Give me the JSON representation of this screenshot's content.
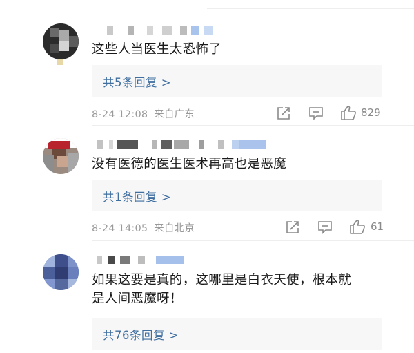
{
  "comments": [
    {
      "text_lines": [
        "这些人当医生太恐怖了"
      ],
      "replies": "共5条回复 >",
      "time": "8-24 12:08",
      "location": "来自广东",
      "likes": "829"
    },
    {
      "text_lines": [
        "没有医德的医生医术再高也是恶魔"
      ],
      "replies": "共1条回复 >",
      "time": "8-24 14:05",
      "location": "来自北京",
      "likes": "61"
    },
    {
      "text_lines": [
        "如果这要是真的，这哪里是白衣天使，根本就",
        "是人间恶魔呀！"
      ],
      "replies": "共76条回复 >"
    }
  ],
  "icons": [
    "share-icon",
    "comment-icon",
    "like-icon"
  ],
  "colors": {
    "link": "#3f6e9f",
    "meta": "#9a9a9a",
    "reply_bg": "#f7f7f7"
  }
}
